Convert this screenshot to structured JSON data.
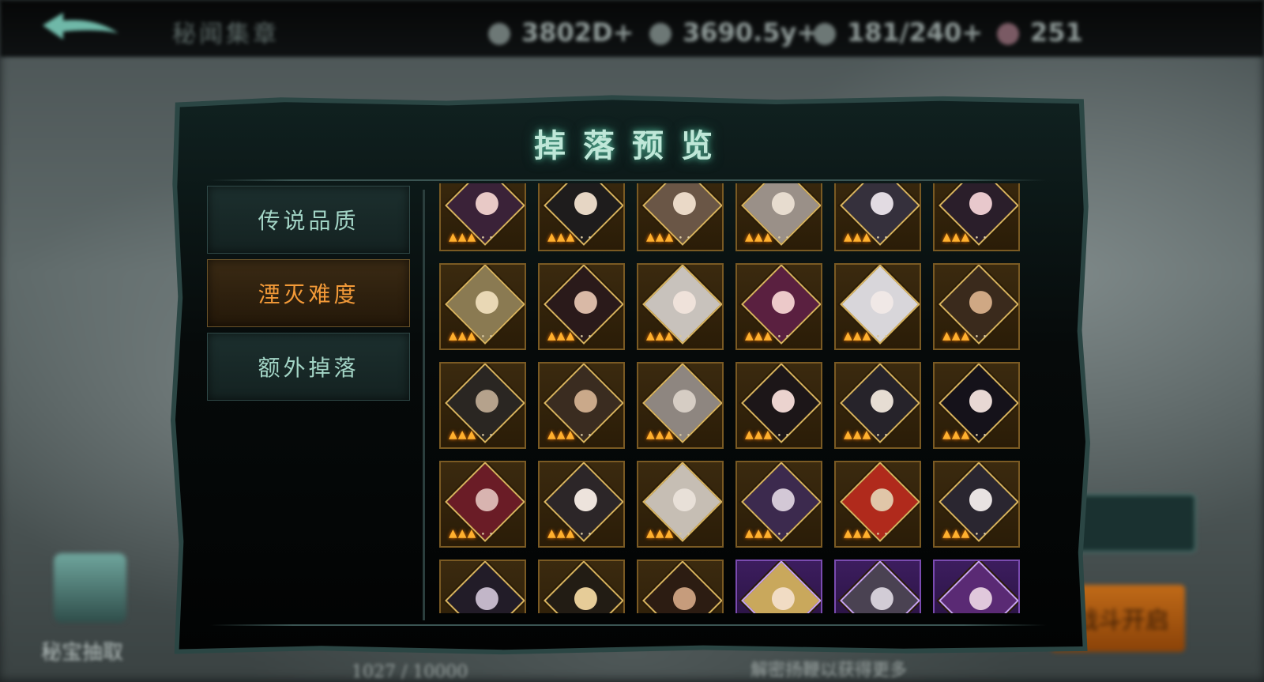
{
  "topbar": {
    "title": "秘闻集章",
    "resources": [
      {
        "icon": "coin-icon",
        "value": "3802D+"
      },
      {
        "icon": "gem-icon",
        "value": "3690.5y+"
      },
      {
        "icon": "stamina-icon",
        "value": "181/240+"
      },
      {
        "icon": "badge-icon",
        "value": "251"
      }
    ]
  },
  "panel": {
    "title": "掉落预览",
    "tabs": [
      {
        "label": "传说品质",
        "active": false
      },
      {
        "label": "湮灭难度",
        "active": true
      },
      {
        "label": "额外掉落",
        "active": false
      }
    ]
  },
  "background": {
    "side_label": "秘宝抽取",
    "right_button_2": "战斗开启",
    "bottom_left": "1027 / 10000",
    "bottom_right": "解密扬鞭以获得更多"
  },
  "drops": {
    "rows": [
      [
        {
          "rarity": "gold",
          "stars": 3,
          "face": "#e8c9c6",
          "hair": "#3a2238"
        },
        {
          "rarity": "gold",
          "stars": 3,
          "face": "#e6d6c4",
          "hair": "#1e1c1c"
        },
        {
          "rarity": "gold",
          "stars": 3,
          "face": "#ead9c7",
          "hair": "#6a5646"
        },
        {
          "rarity": "gold",
          "stars": 3,
          "face": "#e7dccf",
          "hair": "#9a9088"
        },
        {
          "rarity": "gold",
          "stars": 3,
          "face": "#e2dbe2",
          "hair": "#35303c"
        },
        {
          "rarity": "gold",
          "stars": 3,
          "face": "#e8c8cc",
          "hair": "#2a1e2a"
        }
      ],
      [
        {
          "rarity": "gold",
          "stars": 3,
          "face": "#e9d8b5",
          "hair": "#8a7a52"
        },
        {
          "rarity": "gold",
          "stars": 3,
          "face": "#d9b9a6",
          "hair": "#2a1a1a"
        },
        {
          "rarity": "gold",
          "stars": 3,
          "face": "#efe2da",
          "hair": "#c8c2bc"
        },
        {
          "rarity": "gold",
          "stars": 3,
          "face": "#ecc9c9",
          "hair": "#5a2040"
        },
        {
          "rarity": "gold",
          "stars": 3,
          "face": "#f0e8e6",
          "hair": "#d8d6da"
        },
        {
          "rarity": "gold",
          "stars": 3,
          "face": "#cfa884",
          "hair": "#3a2a1c"
        }
      ],
      [
        {
          "rarity": "gold",
          "stars": 3,
          "face": "#b5a28c",
          "hair": "#2a2622"
        },
        {
          "rarity": "gold",
          "stars": 3,
          "face": "#caa98a",
          "hair": "#3a2c20"
        },
        {
          "rarity": "gold",
          "stars": 3,
          "face": "#d6cdc4",
          "hair": "#8e8680"
        },
        {
          "rarity": "gold",
          "stars": 3,
          "face": "#ebd3cf",
          "hair": "#1c1618"
        },
        {
          "rarity": "gold",
          "stars": 3,
          "face": "#e6ddd3",
          "hair": "#26232a"
        },
        {
          "rarity": "gold",
          "stars": 3,
          "face": "#e8d8d4",
          "hair": "#15121a"
        }
      ],
      [
        {
          "rarity": "gold",
          "stars": 3,
          "face": "#d8b4b0",
          "hair": "#6a1c26"
        },
        {
          "rarity": "gold",
          "stars": 3,
          "face": "#ede3dc",
          "hair": "#2c2628"
        },
        {
          "rarity": "gold",
          "stars": 3,
          "face": "#e8e0d8",
          "hair": "#c6beb4"
        },
        {
          "rarity": "gold",
          "stars": 3,
          "face": "#d3c8d6",
          "hair": "#3c2a4e"
        },
        {
          "rarity": "gold",
          "stars": 3,
          "face": "#e0c6a8",
          "hair": "#b02a1c"
        },
        {
          "rarity": "gold",
          "stars": 3,
          "face": "#e8e2e2",
          "hair": "#2a2630"
        }
      ],
      [
        {
          "rarity": "gold",
          "stars": 3,
          "face": "#c2b6c8",
          "hair": "#221c28"
        },
        {
          "rarity": "gold",
          "stars": 3,
          "face": "#e6cc98",
          "hair": "#221c14"
        },
        {
          "rarity": "gold",
          "stars": 3,
          "face": "#c69c7c",
          "hair": "#2c1c12"
        },
        {
          "rarity": "purple",
          "stars": 3,
          "face": "#f1dcc4",
          "hair": "#c9a85c"
        },
        {
          "rarity": "purple",
          "stars": 3,
          "face": "#d2ccd6",
          "hair": "#4a4252"
        },
        {
          "rarity": "purple",
          "stars": 3,
          "face": "#e0c8dc",
          "hair": "#5a2a74"
        }
      ]
    ]
  }
}
